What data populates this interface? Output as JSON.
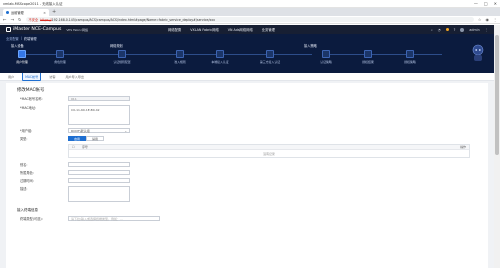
{
  "window": {
    "title": "vmlab-MSScope2011 - 无线接入认证",
    "controls": [
      "—",
      "□",
      "✕"
    ]
  },
  "browser": {
    "tab_label": "运维管理",
    "address": {
      "security": "不安全",
      "scheme": "https://",
      "url": "192.168.0.145/campus/ACS/campus/ACS/index.html#page/Name=fabric_service_deploy#/service/xxx",
      "back_icon": "arrow-left-icon",
      "forward_icon": "arrow-right-icon",
      "reload_icon": "reload-icon"
    }
  },
  "app": {
    "brand": "iMaster NCE-Campus",
    "brand_sub": "VPS Fabric网络",
    "menus": [
      "网络配置",
      "VXLAN Fabric网络",
      "VN Ads网络网络",
      "业务管理"
    ],
    "tools": {
      "user": "admin"
    }
  },
  "breadcrumb": [
    "业务配置",
    "终端管理"
  ],
  "flow": {
    "group1": "接入设备",
    "group2": "网络规划",
    "group3": "接入策略",
    "steps": [
      {
        "name": "用户管理",
        "active": true
      },
      {
        "name": "角色管理",
        "active": false
      },
      {
        "name": "认证规则配置",
        "active": false
      },
      {
        "name": "准入规则",
        "active": false
      },
      {
        "name": "本端接入认证",
        "active": false
      },
      {
        "name": "第三方接入认证",
        "active": false
      },
      {
        "name": "认证策略",
        "active": false
      },
      {
        "name": "授权结果",
        "active": false
      },
      {
        "name": "授权策略",
        "active": false
      }
    ]
  },
  "subtabs": [
    {
      "label": "用户",
      "on": false
    },
    {
      "label": "MAC帐号",
      "on": true
    },
    {
      "label": "访客",
      "on": false
    },
    {
      "label": "用户导入导出",
      "on": false
    }
  ],
  "form": {
    "title": "修改MAC帐号",
    "mac_account_label": "*MAC帐号名称:",
    "mac_account_value": "011",
    "mac_address_label": "*MAC地址:",
    "mac_address_value": "C0-11-60-1E-B0-42",
    "group_label": "*用户组:",
    "group_value": "ROOT\\默认组",
    "auth_label": "类型:",
    "auth_options": [
      "启用",
      "禁用"
    ],
    "table_hd_checkbox": "☐",
    "table_hd_col": "序号",
    "table_hd_col2": "操作",
    "table_empty": "没有记录",
    "alias_label": "别名:",
    "alias_value": "",
    "assign_label": "所属角色:",
    "assign_value": "",
    "expire_label": "过期时间:",
    "expire_value": "",
    "desc_label": "描述:",
    "desc_value": "",
    "section2": "接入终端信息",
    "terminal_label": "终端类型(可选):",
    "terminal_placeholder": "请下拉/输入或选择终端类型，例如：..."
  }
}
